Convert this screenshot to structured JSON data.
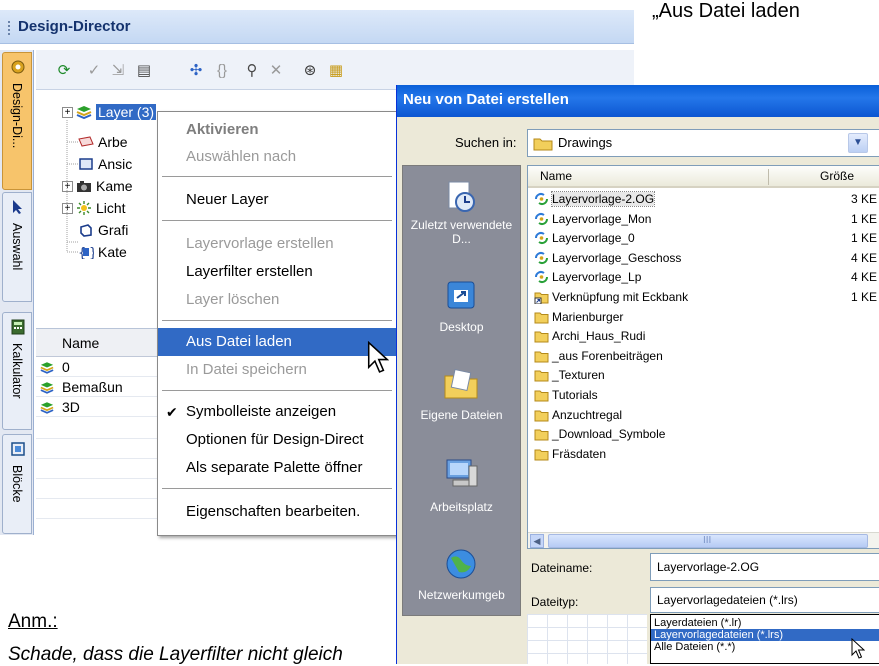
{
  "page": {
    "quote": "„Aus Datei laden",
    "anm": "Anm.:",
    "note": "Schade, dass die Layerfilter nicht gleich"
  },
  "palette": {
    "title": "Design-Director",
    "vertical_tabs": [
      {
        "label": "Design-Di...",
        "icon": "design-director-icon",
        "active": true
      },
      {
        "label": "Auswahl",
        "icon": "selection-arrow-icon"
      },
      {
        "label": "Kalkulator",
        "icon": "calculator-icon"
      },
      {
        "label": "Blöcke",
        "icon": "blocks-icon"
      }
    ],
    "toolbar_icons": [
      "activate-icon",
      "check-icon",
      "select-icon",
      "properties-icon",
      "layer-filter-icon",
      "braces-icon",
      "filter-icon",
      "delete-icon",
      "binoculars-icon",
      "layer-template-icon"
    ],
    "tree": [
      {
        "label": "Layer (3)",
        "icon": "layer-stack-icon",
        "expander": "+",
        "selected": true
      },
      {
        "label": "Arbe",
        "icon": "workplane-icon"
      },
      {
        "label": "Ansic",
        "icon": "view-icon"
      },
      {
        "label": "Kame",
        "icon": "camera-icon",
        "expander": "+"
      },
      {
        "label": "Licht",
        "icon": "light-icon",
        "expander": "+"
      },
      {
        "label": "Grafi",
        "icon": "graphic-icon"
      },
      {
        "label": "Kate",
        "icon": "category-icon"
      }
    ],
    "list_header": "Name",
    "list_rows": [
      {
        "label": "0"
      },
      {
        "label": "Bemaßun"
      },
      {
        "label": "3D"
      }
    ]
  },
  "context_menu": {
    "items": [
      {
        "label": "Aktivieren",
        "style": "bold"
      },
      {
        "label": "Auswählen nach",
        "style": "disabled"
      },
      {
        "separator": true
      },
      {
        "label": "Neuer Layer"
      },
      {
        "separator": true
      },
      {
        "label": "Layervorlage erstellen",
        "style": "disabled"
      },
      {
        "label": "Layerfilter erstellen"
      },
      {
        "label": "Layer löschen",
        "style": "disabled"
      },
      {
        "separator": true
      },
      {
        "label": "Aus Datei laden",
        "style": "highlight"
      },
      {
        "label": "In Datei speichern",
        "style": "disabled"
      },
      {
        "separator": true
      },
      {
        "label": "Symbolleiste anzeigen",
        "checked": true
      },
      {
        "label": "Optionen für Design-Direct"
      },
      {
        "label": "Als separate Palette öffner"
      },
      {
        "separator": true
      },
      {
        "label": "Eigenschaften bearbeiten."
      }
    ]
  },
  "dialog": {
    "title": "Neu von Datei erstellen",
    "look_in_label": "Suchen in:",
    "look_in_value": "Drawings",
    "places": [
      {
        "label": "Zuletzt verwendete D...",
        "icon": "recent-documents-icon"
      },
      {
        "label": "Desktop",
        "icon": "desktop-icon"
      },
      {
        "label": "Eigene Dateien",
        "icon": "my-documents-icon"
      },
      {
        "label": "Arbeitsplatz",
        "icon": "my-computer-icon"
      },
      {
        "label": "Netzwerkumgeb",
        "icon": "network-icon"
      }
    ],
    "columns": {
      "name": "Name",
      "size": "Größe"
    },
    "files": [
      {
        "name": "Layervorlage-2.OG",
        "size": "3 KE",
        "type": "template",
        "selected": true
      },
      {
        "name": "Layervorlage_Mon",
        "size": "1 KE",
        "type": "template"
      },
      {
        "name": "Layervorlage_0",
        "size": "1 KE",
        "type": "template"
      },
      {
        "name": "Layervorlage_Geschoss",
        "size": "4 KE",
        "type": "template"
      },
      {
        "name": "Layervorlage_Lp",
        "size": "4 KE",
        "type": "template"
      },
      {
        "name": "Verknüpfung mit Eckbank",
        "size": "1 KE",
        "type": "shortcut"
      },
      {
        "name": "Marienburger",
        "size": "",
        "type": "folder"
      },
      {
        "name": "Archi_Haus_Rudi",
        "size": "",
        "type": "folder"
      },
      {
        "name": "_aus Forenbeiträgen",
        "size": "",
        "type": "folder"
      },
      {
        "name": "_Texturen",
        "size": "",
        "type": "folder"
      },
      {
        "name": "Tutorials",
        "size": "",
        "type": "folder"
      },
      {
        "name": "Anzuchtregal",
        "size": "",
        "type": "folder"
      },
      {
        "name": "_Download_Symbole",
        "size": "",
        "type": "folder"
      },
      {
        "name": "Fräsdaten",
        "size": "",
        "type": "folder"
      }
    ],
    "scroll_thumb_label": "III",
    "filename_label": "Dateiname:",
    "filename_value": "Layervorlage-2.OG",
    "filetype_label": "Dateityp:",
    "filetype_value": "Layervorlagedateien (*.lrs)",
    "filetype_options": [
      {
        "label": "Layerdateien (*.lr)"
      },
      {
        "label": "Layervorlagedateien (*.lrs)",
        "highlight": true
      },
      {
        "label": "Alle Dateien (*.*)"
      }
    ]
  },
  "colors": {
    "selection": "#316ac5",
    "xp_title": "#0a5fd8",
    "dialog_bg": "#ece9d8",
    "folder": "#f2cf5b"
  }
}
